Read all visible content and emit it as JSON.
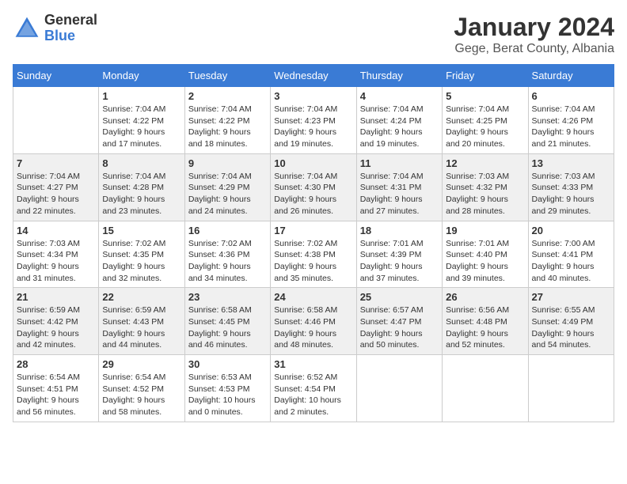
{
  "header": {
    "logo_general": "General",
    "logo_blue": "Blue",
    "month_title": "January 2024",
    "subtitle": "Gege, Berat County, Albania"
  },
  "days_of_week": [
    "Sunday",
    "Monday",
    "Tuesday",
    "Wednesday",
    "Thursday",
    "Friday",
    "Saturday"
  ],
  "weeks": [
    {
      "cells": [
        {
          "day": "",
          "info": ""
        },
        {
          "day": "1",
          "info": "Sunrise: 7:04 AM\nSunset: 4:22 PM\nDaylight: 9 hours\nand 17 minutes."
        },
        {
          "day": "2",
          "info": "Sunrise: 7:04 AM\nSunset: 4:22 PM\nDaylight: 9 hours\nand 18 minutes."
        },
        {
          "day": "3",
          "info": "Sunrise: 7:04 AM\nSunset: 4:23 PM\nDaylight: 9 hours\nand 19 minutes."
        },
        {
          "day": "4",
          "info": "Sunrise: 7:04 AM\nSunset: 4:24 PM\nDaylight: 9 hours\nand 19 minutes."
        },
        {
          "day": "5",
          "info": "Sunrise: 7:04 AM\nSunset: 4:25 PM\nDaylight: 9 hours\nand 20 minutes."
        },
        {
          "day": "6",
          "info": "Sunrise: 7:04 AM\nSunset: 4:26 PM\nDaylight: 9 hours\nand 21 minutes."
        }
      ],
      "shade": false
    },
    {
      "cells": [
        {
          "day": "7",
          "info": "Sunrise: 7:04 AM\nSunset: 4:27 PM\nDaylight: 9 hours\nand 22 minutes."
        },
        {
          "day": "8",
          "info": "Sunrise: 7:04 AM\nSunset: 4:28 PM\nDaylight: 9 hours\nand 23 minutes."
        },
        {
          "day": "9",
          "info": "Sunrise: 7:04 AM\nSunset: 4:29 PM\nDaylight: 9 hours\nand 24 minutes."
        },
        {
          "day": "10",
          "info": "Sunrise: 7:04 AM\nSunset: 4:30 PM\nDaylight: 9 hours\nand 26 minutes."
        },
        {
          "day": "11",
          "info": "Sunrise: 7:04 AM\nSunset: 4:31 PM\nDaylight: 9 hours\nand 27 minutes."
        },
        {
          "day": "12",
          "info": "Sunrise: 7:03 AM\nSunset: 4:32 PM\nDaylight: 9 hours\nand 28 minutes."
        },
        {
          "day": "13",
          "info": "Sunrise: 7:03 AM\nSunset: 4:33 PM\nDaylight: 9 hours\nand 29 minutes."
        }
      ],
      "shade": true
    },
    {
      "cells": [
        {
          "day": "14",
          "info": "Sunrise: 7:03 AM\nSunset: 4:34 PM\nDaylight: 9 hours\nand 31 minutes."
        },
        {
          "day": "15",
          "info": "Sunrise: 7:02 AM\nSunset: 4:35 PM\nDaylight: 9 hours\nand 32 minutes."
        },
        {
          "day": "16",
          "info": "Sunrise: 7:02 AM\nSunset: 4:36 PM\nDaylight: 9 hours\nand 34 minutes."
        },
        {
          "day": "17",
          "info": "Sunrise: 7:02 AM\nSunset: 4:38 PM\nDaylight: 9 hours\nand 35 minutes."
        },
        {
          "day": "18",
          "info": "Sunrise: 7:01 AM\nSunset: 4:39 PM\nDaylight: 9 hours\nand 37 minutes."
        },
        {
          "day": "19",
          "info": "Sunrise: 7:01 AM\nSunset: 4:40 PM\nDaylight: 9 hours\nand 39 minutes."
        },
        {
          "day": "20",
          "info": "Sunrise: 7:00 AM\nSunset: 4:41 PM\nDaylight: 9 hours\nand 40 minutes."
        }
      ],
      "shade": false
    },
    {
      "cells": [
        {
          "day": "21",
          "info": "Sunrise: 6:59 AM\nSunset: 4:42 PM\nDaylight: 9 hours\nand 42 minutes."
        },
        {
          "day": "22",
          "info": "Sunrise: 6:59 AM\nSunset: 4:43 PM\nDaylight: 9 hours\nand 44 minutes."
        },
        {
          "day": "23",
          "info": "Sunrise: 6:58 AM\nSunset: 4:45 PM\nDaylight: 9 hours\nand 46 minutes."
        },
        {
          "day": "24",
          "info": "Sunrise: 6:58 AM\nSunset: 4:46 PM\nDaylight: 9 hours\nand 48 minutes."
        },
        {
          "day": "25",
          "info": "Sunrise: 6:57 AM\nSunset: 4:47 PM\nDaylight: 9 hours\nand 50 minutes."
        },
        {
          "day": "26",
          "info": "Sunrise: 6:56 AM\nSunset: 4:48 PM\nDaylight: 9 hours\nand 52 minutes."
        },
        {
          "day": "27",
          "info": "Sunrise: 6:55 AM\nSunset: 4:49 PM\nDaylight: 9 hours\nand 54 minutes."
        }
      ],
      "shade": true
    },
    {
      "cells": [
        {
          "day": "28",
          "info": "Sunrise: 6:54 AM\nSunset: 4:51 PM\nDaylight: 9 hours\nand 56 minutes."
        },
        {
          "day": "29",
          "info": "Sunrise: 6:54 AM\nSunset: 4:52 PM\nDaylight: 9 hours\nand 58 minutes."
        },
        {
          "day": "30",
          "info": "Sunrise: 6:53 AM\nSunset: 4:53 PM\nDaylight: 10 hours\nand 0 minutes."
        },
        {
          "day": "31",
          "info": "Sunrise: 6:52 AM\nSunset: 4:54 PM\nDaylight: 10 hours\nand 2 minutes."
        },
        {
          "day": "",
          "info": ""
        },
        {
          "day": "",
          "info": ""
        },
        {
          "day": "",
          "info": ""
        }
      ],
      "shade": false
    }
  ]
}
